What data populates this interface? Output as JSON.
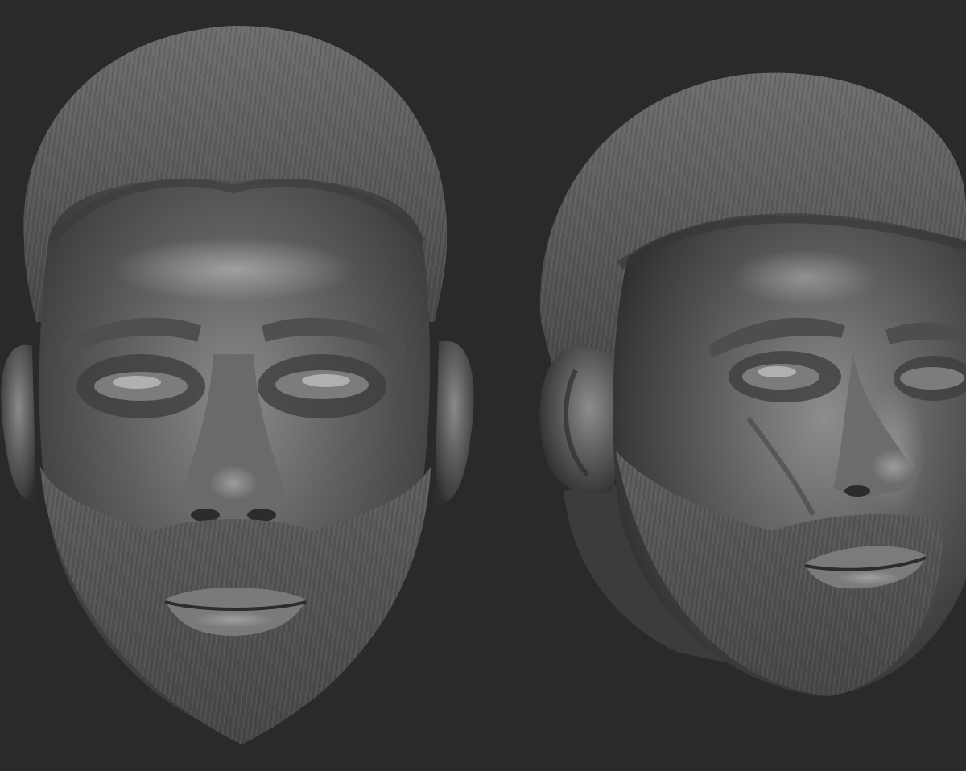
{
  "viewport": {
    "background": "#2a2a2a"
  },
  "render": {
    "material": "matcap-gray-clay",
    "material_colors": {
      "base": "#6b6b6b",
      "mid": "#555555",
      "dark": "#2e2e2e",
      "highlight": "#c9c9c9"
    }
  },
  "sculpts": [
    {
      "name": "head-front-view",
      "view": "front"
    },
    {
      "name": "head-three-quarter-view",
      "view": "three-quarter"
    }
  ]
}
